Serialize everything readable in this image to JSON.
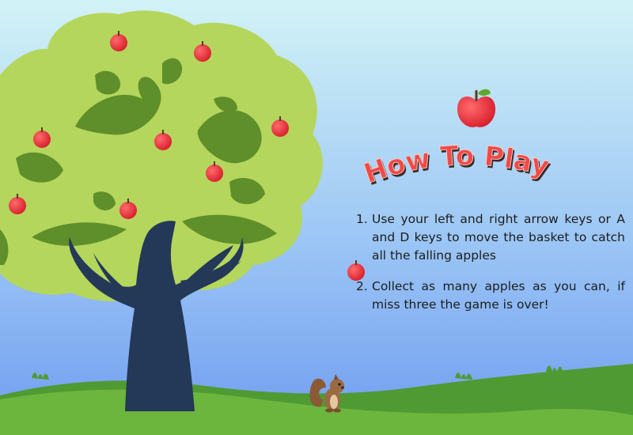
{
  "title": "How To Play",
  "instructions": [
    {
      "number": "1.",
      "text": "Use your left and right arrow keys or A and D keys to move the basket to catch all the falling apples"
    },
    {
      "number": "2.",
      "text": "Collect as many apples as you can, if miss three the game is over!"
    }
  ],
  "colors": {
    "sky_top": "#d2f3f6",
    "sky_bottom": "#6f9cf0",
    "title": "#f04a4a",
    "title_shadow": "#3a2a2a",
    "apple": "#e8283a",
    "foliage_light": "#b4d65c",
    "foliage_dark": "#5f8f2a",
    "trunk": "#243857",
    "grass": "#64a93a"
  },
  "characters": [
    "squirrel"
  ]
}
